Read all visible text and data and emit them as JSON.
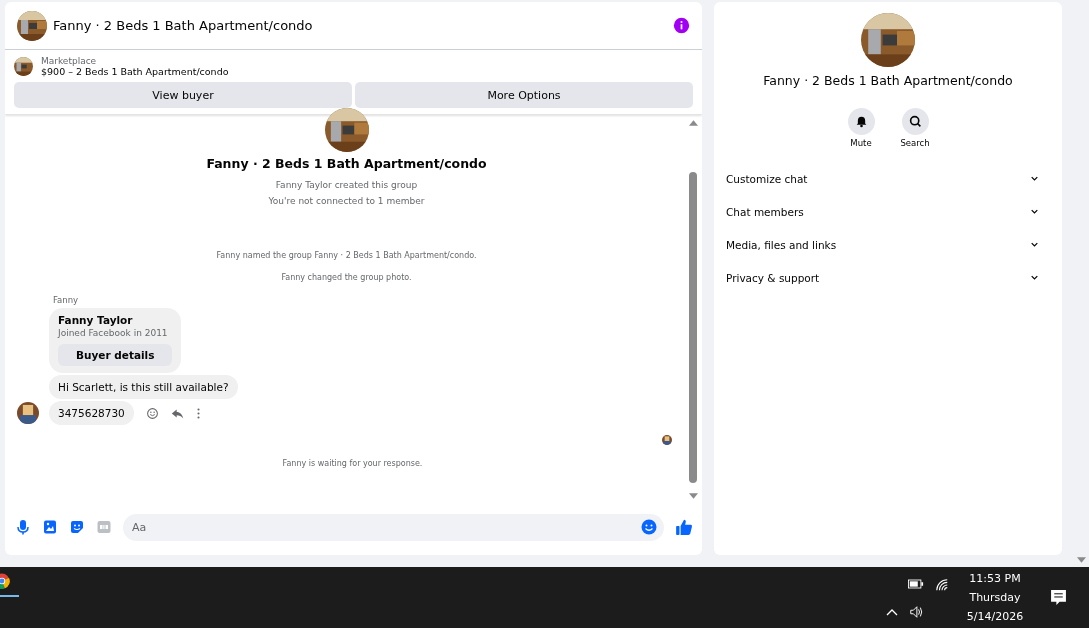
{
  "header": {
    "title": "Fanny · 2 Beds 1 Bath Apartment/condo"
  },
  "listing": {
    "source": "Marketplace",
    "title": "$900 – 2 Beds 1 Bath Apartment/condo",
    "buttons": [
      "View buyer",
      "More Options"
    ]
  },
  "chat": {
    "title": "Fanny · 2 Beds 1 Bath Apartment/condo",
    "intro": [
      "Fanny Taylor created this group",
      "You're not connected to 1 member"
    ],
    "events": [
      "Fanny named the group Fanny · 2 Beds 1 Bath Apartment/condo.",
      "Fanny changed the group photo."
    ],
    "sender": "Fanny",
    "card": {
      "name": "Fanny Taylor",
      "subtitle": "Joined Facebook in 2011",
      "button": "Buyer details"
    },
    "messages": [
      "Hi Scarlett, is this still available?",
      "3475628730"
    ],
    "status": "Fanny is waiting for your response."
  },
  "composer": {
    "placeholder": "Aa"
  },
  "details": {
    "title": "Fanny · 2 Beds 1 Bath Apartment/condo",
    "actions": [
      {
        "kind": "mute",
        "label": "Mute"
      },
      {
        "kind": "search",
        "label": "Search"
      }
    ],
    "sections": [
      {
        "label": "Customize chat",
        "expanded": false
      },
      {
        "label": "Chat members",
        "expanded": false
      },
      {
        "label": "Media, files and links",
        "expanded": false
      },
      {
        "label": "Privacy & support",
        "expanded": false
      }
    ]
  },
  "taskbar": {
    "time": "11:53 PM",
    "day": "Thursday",
    "date": "5/14/2026"
  }
}
